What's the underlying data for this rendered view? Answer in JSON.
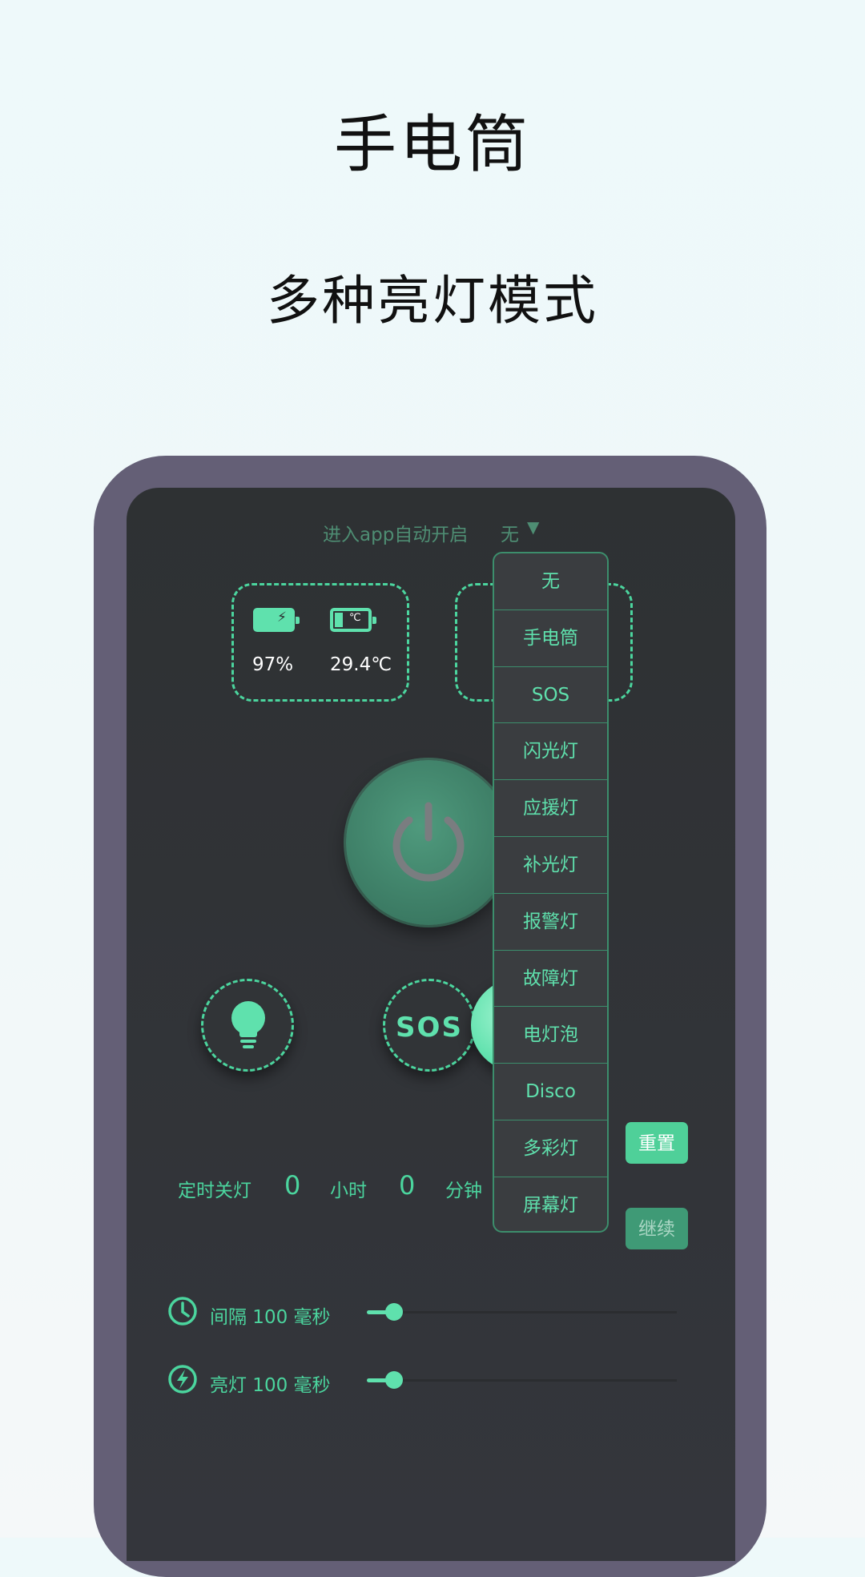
{
  "header": {
    "title": "手电筒",
    "subtitle": "多种亮灯模式"
  },
  "app": {
    "auto_open_label": "进入app自动开启",
    "auto_open_value": "无",
    "battery_percent": "97%",
    "battery_temp": "29.4℃",
    "battery_temp_icon_label": "℃",
    "sos_label": "SOS",
    "timer": {
      "label": "定时关灯",
      "hours": "0",
      "hours_unit": "小时",
      "minutes": "0",
      "minutes_unit": "分钟"
    },
    "reset_label": "重置",
    "continue_label": "继续",
    "interval_label": "间隔 100 毫秒",
    "on_label": "亮灯 100 毫秒",
    "mode_options": [
      "无",
      "手电筒",
      "SOS",
      "闪光灯",
      "应援灯",
      "补光灯",
      "报警灯",
      "故障灯",
      "电灯泡",
      "Disco",
      "多彩灯",
      "屏幕灯"
    ]
  },
  "colors": {
    "accent": "#5fe1ad",
    "screen_bg": "#303336",
    "frame": "#645f76",
    "page_bg": "#eef9fa"
  }
}
